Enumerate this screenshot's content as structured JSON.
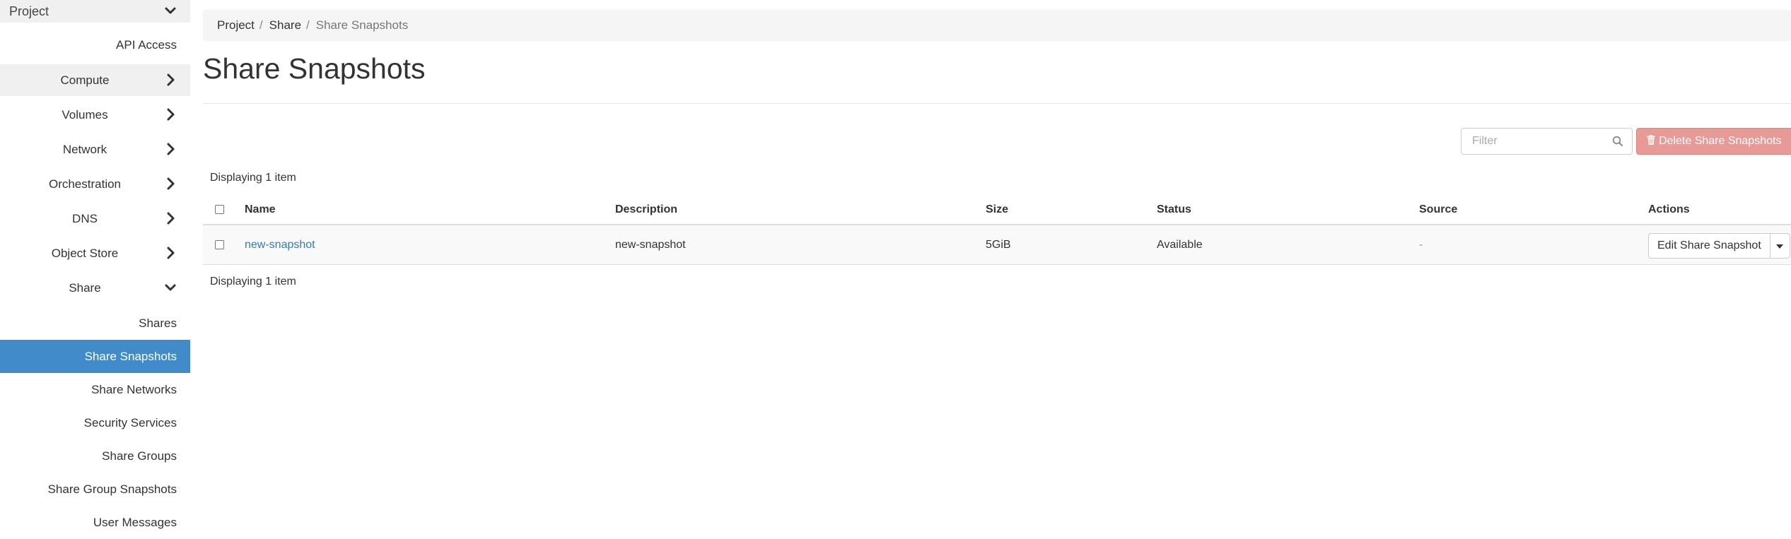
{
  "sidebar": {
    "project_label": "Project",
    "api_access": "API Access",
    "groups": [
      {
        "label": "Compute"
      },
      {
        "label": "Volumes"
      },
      {
        "label": "Network"
      },
      {
        "label": "Orchestration"
      },
      {
        "label": "DNS"
      },
      {
        "label": "Object Store"
      },
      {
        "label": "Share"
      }
    ],
    "share_items": [
      {
        "label": "Shares"
      },
      {
        "label": "Share Snapshots"
      },
      {
        "label": "Share Networks"
      },
      {
        "label": "Security Services"
      },
      {
        "label": "Share Groups"
      },
      {
        "label": "Share Group Snapshots"
      },
      {
        "label": "User Messages"
      }
    ]
  },
  "breadcrumb": {
    "items": [
      "Project",
      "Share",
      "Share Snapshots"
    ],
    "separator": "/"
  },
  "page": {
    "title": "Share Snapshots"
  },
  "toolbar": {
    "filter_placeholder": "Filter",
    "delete_label": "Delete Share Snapshots"
  },
  "table": {
    "count_top": "Displaying 1 item",
    "count_bottom": "Displaying 1 item",
    "columns": {
      "name": "Name",
      "description": "Description",
      "size": "Size",
      "status": "Status",
      "source": "Source",
      "actions": "Actions"
    },
    "rows": [
      {
        "name": "new-snapshot",
        "description": "new-snapshot",
        "size": "5GiB",
        "status": "Available",
        "source": "-",
        "action_label": "Edit Share Snapshot"
      }
    ]
  },
  "colors": {
    "active_nav": "#428bca",
    "link": "#337ab7",
    "danger_disabled": "#e89a97"
  }
}
